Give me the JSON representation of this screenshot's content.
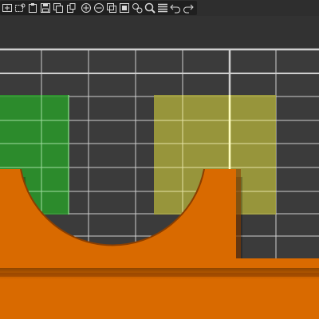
{
  "toolbar": {
    "buttons": [
      {
        "icon": "new-layer-icon"
      },
      {
        "icon": "open-shape-icon"
      },
      {
        "icon": "clipboard-icon"
      },
      {
        "icon": "save-icon"
      },
      {
        "icon": "copy-icon"
      },
      {
        "icon": "paste-icon"
      },
      {
        "icon": "zoom-in-icon"
      },
      {
        "icon": "zoom-out-icon"
      },
      {
        "icon": "duplicate-icon"
      },
      {
        "icon": "group-icon"
      },
      {
        "icon": "settings-icon"
      },
      {
        "icon": "magnifier-icon"
      },
      {
        "icon": "menu-icon"
      },
      {
        "icon": "undo-icon"
      },
      {
        "icon": "redo-icon"
      }
    ]
  },
  "canvas": {
    "colors": {
      "background": "#3b3b3b",
      "top_band": "#323232",
      "grid": "#cfcfcf",
      "orange": "#d96a00",
      "orange_shadow": "#9a4600",
      "green": "#2a9a2a",
      "olive": "#a8a63c",
      "highlight": "#ffffc0"
    }
  }
}
